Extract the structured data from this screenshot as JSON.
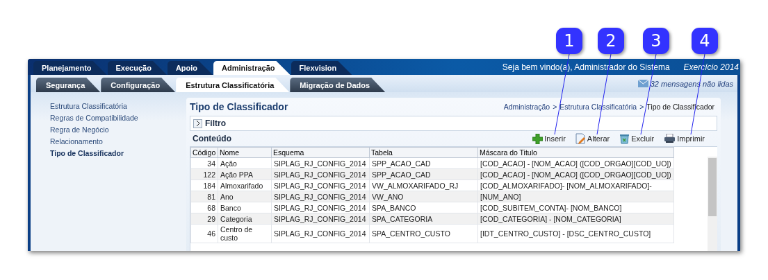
{
  "top_tabs": [
    {
      "label": "Planejamento",
      "selected": false
    },
    {
      "label": "Execução",
      "selected": false
    },
    {
      "label": "Apoio",
      "selected": false
    },
    {
      "label": "Administração",
      "selected": true
    },
    {
      "label": "Flexvision",
      "selected": false
    }
  ],
  "welcome": "Seja bem vindo(a), Administrador do Sistema",
  "exercise": "Exercício 2014",
  "sub_tabs": [
    {
      "label": "Segurança",
      "selected": false
    },
    {
      "label": "Configuração",
      "selected": false
    },
    {
      "label": "Estrutura Classificatória",
      "selected": true
    },
    {
      "label": "Migração de Dados",
      "selected": false
    }
  ],
  "messages": "32 mensagens não lidas",
  "sidebar": {
    "items": [
      {
        "label": "Estrutura Classificatória",
        "selected": false
      },
      {
        "label": "Regras de Compatibilidade",
        "selected": false
      },
      {
        "label": "Regra de Negócio",
        "selected": false
      },
      {
        "label": "Relacionamento",
        "selected": false
      },
      {
        "label": "Tipo de Classificador",
        "selected": true
      }
    ]
  },
  "page_title": "Tipo de Classificador",
  "breadcrumb": [
    "Administração",
    ">",
    "Estrutura Classificatória",
    ">",
    "Tipo de Classificador"
  ],
  "filter": {
    "label": "Filtro",
    "expanded": false
  },
  "content_label": "Conteúdo",
  "toolbar": [
    {
      "kind": "insert",
      "label": "Inserir"
    },
    {
      "kind": "edit",
      "label": "Alterar"
    },
    {
      "kind": "delete",
      "label": "Excluir"
    },
    {
      "kind": "print",
      "label": "Imprimir"
    }
  ],
  "table": {
    "columns": [
      "Código",
      "Nome",
      "Esquema",
      "Tabela",
      "Máscara do Titulo"
    ],
    "rows": [
      [
        "34",
        "Ação",
        "SIPLAG_RJ_CONFIG_2014",
        "SPP_ACAO_CAD",
        "[COD_ACAO] - [NOM_ACAO] ([COD_ORGAO][COD_UO])"
      ],
      [
        "122",
        "Ação PPA",
        "SIPLAG_RJ_CONFIG_2014",
        "SPP_ACAO_CAD",
        "[COD_ACAO] - [NOM_ACAO] ([COD_ORGAO][COD_UO])"
      ],
      [
        "184",
        "Almoxarifado",
        "SIPLAG_RJ_CONFIG_2014",
        "VW_ALMOXARIFADO_RJ",
        "[COD_ALMOXARIFADO]- [NOM_ALMOXARIFADO]-"
      ],
      [
        "81",
        "Ano",
        "SIPLAG_RJ_CONFIG_2014",
        "VW_ANO",
        "[NUM_ANO]"
      ],
      [
        "68",
        "Banco",
        "SIPLAG_RJ_CONFIG_2014",
        "SPA_BANCO",
        "[COD_SUBITEM_CONTA]- [NOM_BANCO]"
      ],
      [
        "29",
        "Categoria",
        "SIPLAG_RJ_CONFIG_2014",
        "SPA_CATEGORIA",
        "[COD_CATEGORIA] - [NOM_CATEGORIA]"
      ],
      [
        "46",
        "Centro de custo",
        "SIPLAG_RJ_CONFIG_2014",
        "SPA_CENTRO_CUSTO",
        "[IDT_CENTRO_CUSTO] - [DSC_CENTRO_CUSTO]"
      ]
    ]
  },
  "callouts": [
    "1",
    "2",
    "3",
    "4"
  ]
}
